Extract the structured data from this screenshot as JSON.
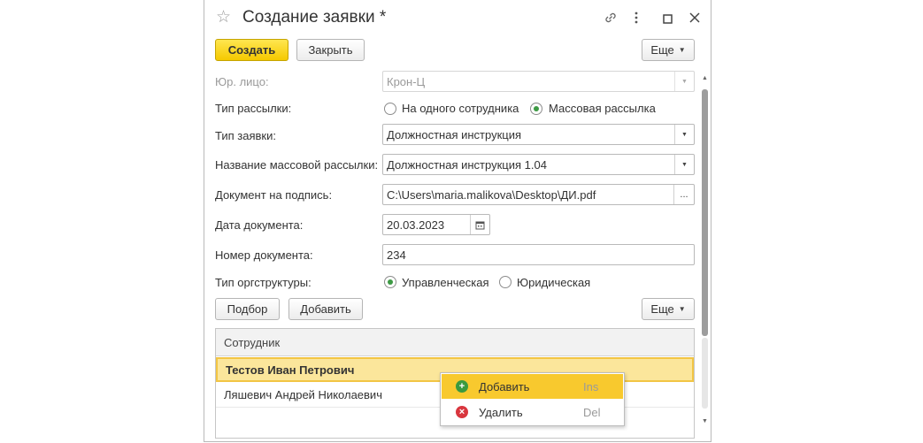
{
  "window": {
    "title": "Создание заявки *",
    "icons": [
      "star-icon",
      "link-icon",
      "more-icon",
      "maximize-icon",
      "close-icon"
    ]
  },
  "toolbar": {
    "create_label": "Создать",
    "close_label": "Закрыть",
    "more_label": "Еще"
  },
  "form": {
    "legal_entity": {
      "label": "Юр. лицо:",
      "value": "Крон-Ц"
    },
    "mailing_type": {
      "label": "Тип рассылки:",
      "options": [
        "На одного сотрудника",
        "Массовая рассылка"
      ],
      "selected": "Массовая рассылка"
    },
    "request_type": {
      "label": "Тип заявки:",
      "value": "Должностная инструкция"
    },
    "mass_mailing_name": {
      "label": "Название массовой рассылки:",
      "value": "Должностная инструкция 1.04"
    },
    "document_to_sign": {
      "label": "Документ на подпись:",
      "value": "C:\\Users\\maria.malikova\\Desktop\\ДИ.pdf",
      "button": "..."
    },
    "document_date": {
      "label": "Дата документа:",
      "value": "20.03.2023"
    },
    "document_number": {
      "label": "Номер документа:",
      "value": "234"
    },
    "org_structure_type": {
      "label": "Тип оргструктуры:",
      "options": [
        "Управленческая",
        "Юридическая"
      ],
      "selected": "Управленческая"
    }
  },
  "table_toolbar": {
    "pick_label": "Подбор",
    "add_label": "Добавить",
    "more_label": "Еще"
  },
  "table": {
    "column": "Сотрудник",
    "rows": [
      "Тестов Иван Петрович",
      "Ляшевич Андрей Николаевич"
    ],
    "selected_index": 0
  },
  "context_menu": {
    "items": [
      {
        "label": "Добавить",
        "shortcut": "Ins",
        "icon": "add-icon",
        "color": "#3a9a3f"
      },
      {
        "label": "Удалить",
        "shortcut": "Del",
        "icon": "delete-icon",
        "color": "#d9363e"
      }
    ]
  },
  "colors": {
    "primary_button": "#f5c900",
    "selection": "#fbe69b",
    "menu_highlight": "#f8c92e",
    "radio_dot": "#3d9a44"
  }
}
